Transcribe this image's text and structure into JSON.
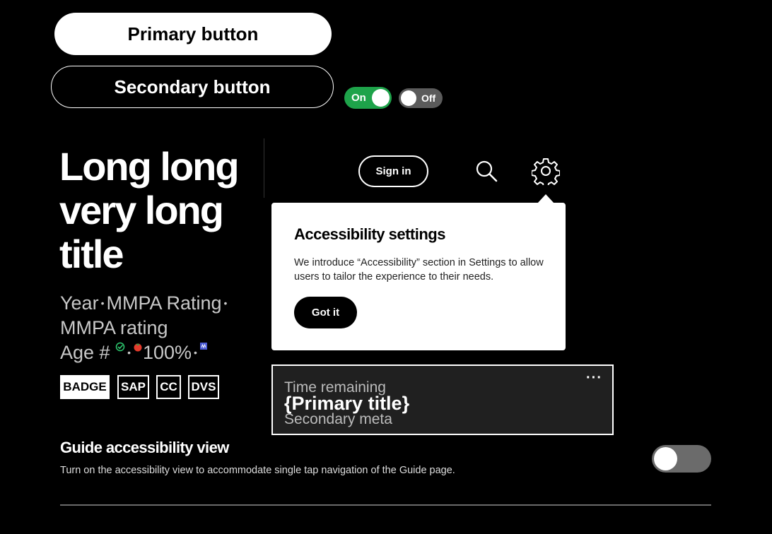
{
  "buttons": {
    "primary_label": "Primary button",
    "secondary_label": "Secondary button"
  },
  "toggles": {
    "on_label": "On",
    "off_label": "Off"
  },
  "content": {
    "title": "Long long very long title",
    "meta_year": "Year",
    "meta_rating1": "MMPA Rating",
    "meta_rating2": "MMPA rating",
    "meta_age": "Age #",
    "meta_score": "100%",
    "badges": [
      "BADGE",
      "SAP",
      "CC",
      "DVS"
    ]
  },
  "header": {
    "signin_label": "Sign in",
    "icons": [
      "search-icon",
      "gear-icon"
    ]
  },
  "popover": {
    "title": "Accessibility settings",
    "body": "We introduce “Accessibility” section in Settings to allow users to tailor the experience to their needs.",
    "button_label": "Got it"
  },
  "card": {
    "eyebrow": "Time remaining",
    "title": "{Primary title}",
    "meta": "Secondary meta",
    "more": "···"
  },
  "guide": {
    "title": "Guide accessibility view",
    "description": "Turn on the accessibility view to accommodate single tap navigation of the Guide page.",
    "toggle_state": "off"
  },
  "colors": {
    "background": "#000000",
    "toggle_on": "#1ea34a",
    "toggle_off": "#5b5b5b",
    "card_bg": "#202020"
  }
}
